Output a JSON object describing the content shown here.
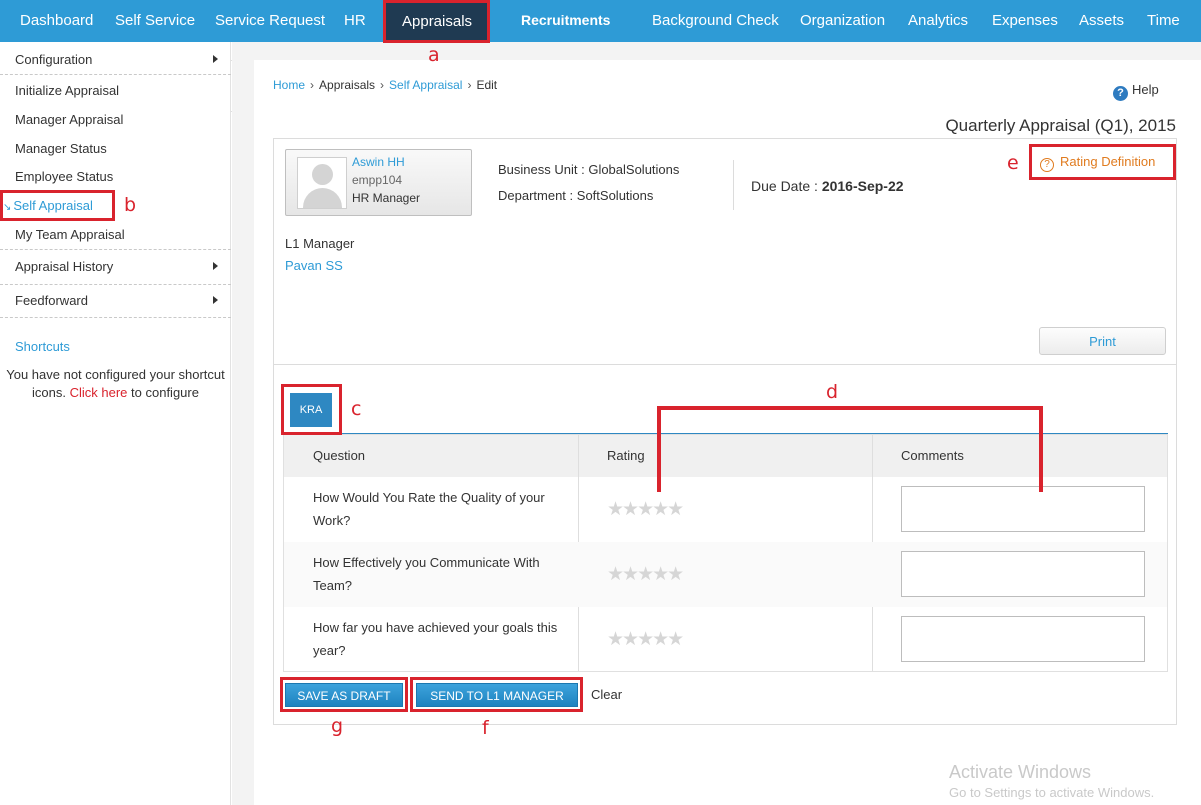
{
  "nav": {
    "items": [
      "Dashboard",
      "Self Service",
      "Service Request",
      "HR",
      "Appraisals",
      "Recruitments",
      "Background Check",
      "Organization",
      "Analytics",
      "Expenses",
      "Assets",
      "Time"
    ]
  },
  "sidebar": {
    "items": [
      "Configuration",
      "Initialize Appraisal",
      "Manager Appraisal",
      "Manager Status",
      "Employee Status",
      "Self Appraisal",
      "My Team Appraisal",
      "Appraisal History",
      "Feedforward"
    ],
    "shortcuts_title": "Shortcuts",
    "shortcuts_text_1": "You have not configured your shortcut icons.",
    "shortcuts_link": "Click here",
    "shortcuts_text_2": "to configure"
  },
  "breadcrumb": [
    "Home",
    "Appraisals",
    "Self Appraisal",
    "Edit"
  ],
  "help_label": "Help",
  "page_title": "Quarterly Appraisal (Q1), 2015",
  "employee": {
    "name": "Aswin HH",
    "id": "empp104",
    "role": "HR Manager",
    "business_unit_label": "Business Unit :",
    "business_unit": "GlobalSolutions",
    "department_label": "Department :",
    "department": "SoftSolutions",
    "due_date_label": "Due Date :",
    "due_date": "2016-Sep-22",
    "l1_label": "L1 Manager",
    "l1_name": "Pavan SS"
  },
  "rating_definition": "Rating Definition",
  "print_label": "Print",
  "tab_label": "KRA",
  "table": {
    "headers": [
      "Question",
      "Rating",
      "Comments"
    ],
    "rows": [
      {
        "question": "How Would You Rate the Quality of your Work?",
        "stars": "★★★★★",
        "comment": ""
      },
      {
        "question": "How Effectively you Communicate With Team?",
        "stars": "★★★★★",
        "comment": ""
      },
      {
        "question": "How far you have achieved your goals this year?",
        "stars": "★★★★★",
        "comment": ""
      }
    ]
  },
  "buttons": {
    "save_draft": "SAVE AS DRAFT",
    "send": "SEND TO L1 MANAGER",
    "clear": "Clear"
  },
  "annotations": [
    "a",
    "b",
    "c",
    "d",
    "e",
    "f",
    "g"
  ],
  "watermark": {
    "line1": "Activate Windows",
    "line2": "Go to Settings to activate Windows."
  },
  "colors": {
    "nav_bg": "#2e9bd6",
    "nav_active": "#1f3a52",
    "annotation_red": "#d9232d",
    "link_blue": "#2e9bd6",
    "rating_orange": "#e07b1f"
  }
}
